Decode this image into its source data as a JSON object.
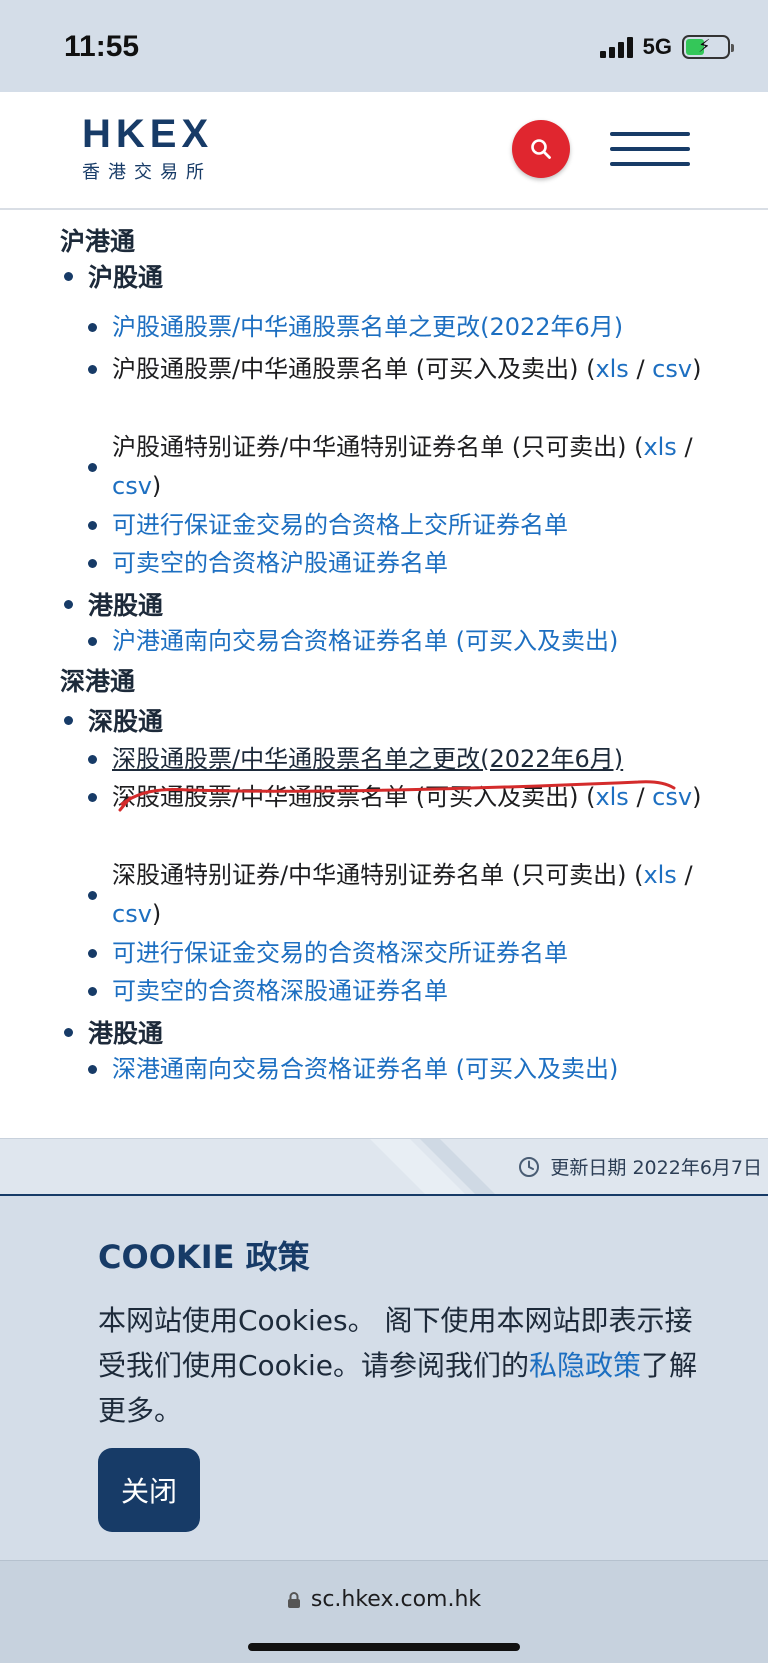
{
  "status": {
    "time": "11:55",
    "network": "5G"
  },
  "header": {
    "logo_main": "HKEX",
    "logo_sub": "香港交易所"
  },
  "sections": {
    "sh": {
      "title": "沪港通",
      "north": {
        "label": "沪股通",
        "item1": "沪股通股票/中华通股票名单之更改(2022年6月)",
        "item2_text": "沪股通股票/中华通股票名单 (可买入及卖出) (",
        "item2_xls": "xls",
        "item2_csv": "csv",
        "item3_text": "沪股通特别证券/中华通特别证券名单 (只可卖出) (",
        "item3_xls": "xls",
        "item3_csv": "csv",
        "item4": "可进行保证金交易的合资格上交所证券名单",
        "item5": "可卖空的合资格沪股通证券名单"
      },
      "south": {
        "label": "港股通",
        "item1": "沪港通南向交易合资格证券名单 (可买入及卖出)"
      }
    },
    "sz": {
      "title": "深港通",
      "north": {
        "label": "深股通",
        "item1": "深股通股票/中华通股票名单之更改(2022年6月)",
        "item2_text": "深股通股票/中华通股票名单 (可买入及卖出) (",
        "item2_xls": "xls",
        "item2_csv": "csv",
        "item3_text": "深股通特别证券/中华通特别证券名单 (只可卖出) (",
        "item3_xls": "xls",
        "item3_csv": "csv",
        "item4": "可进行保证金交易的合资格深交所证券名单",
        "item5": "可卖空的合资格深股通证券名单"
      },
      "south": {
        "label": "港股通",
        "item1": "深港通南向交易合资格证券名单 (可买入及卖出)"
      }
    }
  },
  "updated": "更新日期 2022年6月7日",
  "cookie": {
    "title": "COOKIE 政策",
    "body_part1": "本网站使用Cookies。 阁下使用本网站即表示接受我们使用Cookie。请参阅我们的",
    "privacy_link": "私隐政策",
    "body_part2": "了解更多。",
    "close_label": "关闭"
  },
  "url": "sc.hkex.com.hk",
  "colors": {
    "brand_navy": "#173b67",
    "link_blue": "#1d6fc1",
    "search_red": "#e0262f"
  }
}
